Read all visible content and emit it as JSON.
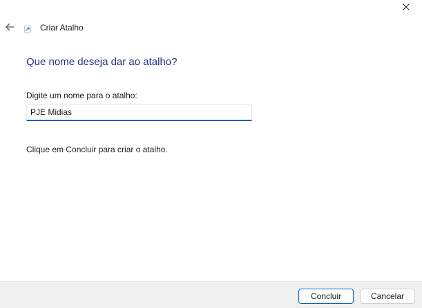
{
  "window": {
    "title": "Criar Atalho",
    "close_icon": "close-icon",
    "back_icon": "back-arrow-icon",
    "title_icon": "shortcut-icon"
  },
  "main": {
    "heading": "Que nome deseja dar ao atalho?",
    "field_label": "Digite um nome para o atalho:",
    "field_value": "PJE Midias",
    "hint": "Clique em Concluir para criar o atalho."
  },
  "footer": {
    "finish_label": "Concluir",
    "cancel_label": "Cancelar"
  },
  "colors": {
    "accent": "#0a5fb4",
    "heading": "#1e3287",
    "footer_bg": "#f0f0f0"
  }
}
